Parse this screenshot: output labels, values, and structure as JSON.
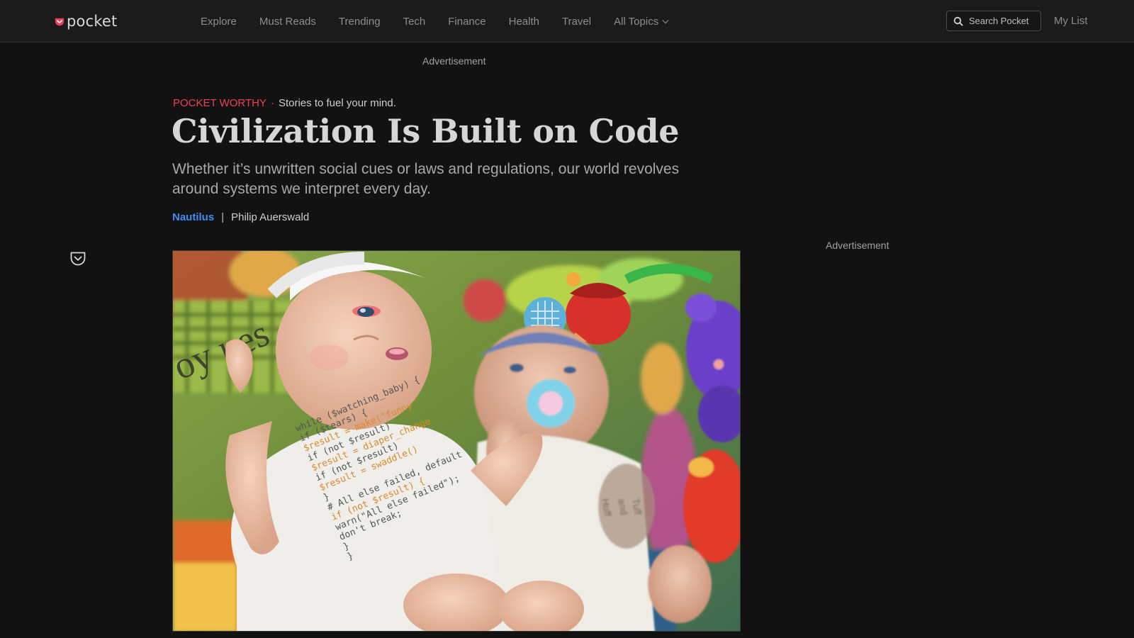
{
  "header": {
    "logo_text": "pocket",
    "nav": [
      "Explore",
      "Must Reads",
      "Trending",
      "Tech",
      "Finance",
      "Health",
      "Travel",
      "All Topics"
    ],
    "search_placeholder": "Search Pocket",
    "my_list": "My List"
  },
  "ads": {
    "top": "Advertisement",
    "right": "Advertisement"
  },
  "article": {
    "eyebrow_label": "POCKET WORTHY",
    "eyebrow_separator": "·",
    "eyebrow_tagline": "Stories to fuel your mind.",
    "title": "Civilization Is Built on Code",
    "subtitle": "Whether it’s unwritten social cues or laws and regulations, our world revolves around systems we interpret every day.",
    "publisher": "Nautilus",
    "byline_separator": "|",
    "author": "Philip Auerswald"
  },
  "hero_onesie_code": [
    "while ($watching_baby) {",
    "  if ($tears) {",
    "    $result = make(\"funny",
    "    if (not $result)",
    "      $result = diaper_change",
    "    if (not $result)",
    "      $result = swaddle()",
    "  }",
    "  # All else failed, default",
    "  if (not $result) {",
    "    warn(\"All else failed\");",
    "    don't break;",
    "  }",
    "}"
  ],
  "colors": {
    "accent": "#ef4056",
    "link": "#3d8ef2",
    "background": "#121212",
    "header_bg": "#1b1b1b"
  },
  "icons": [
    "pocket-logo-icon",
    "chevron-down-icon",
    "search-icon",
    "save-to-pocket-icon"
  ]
}
